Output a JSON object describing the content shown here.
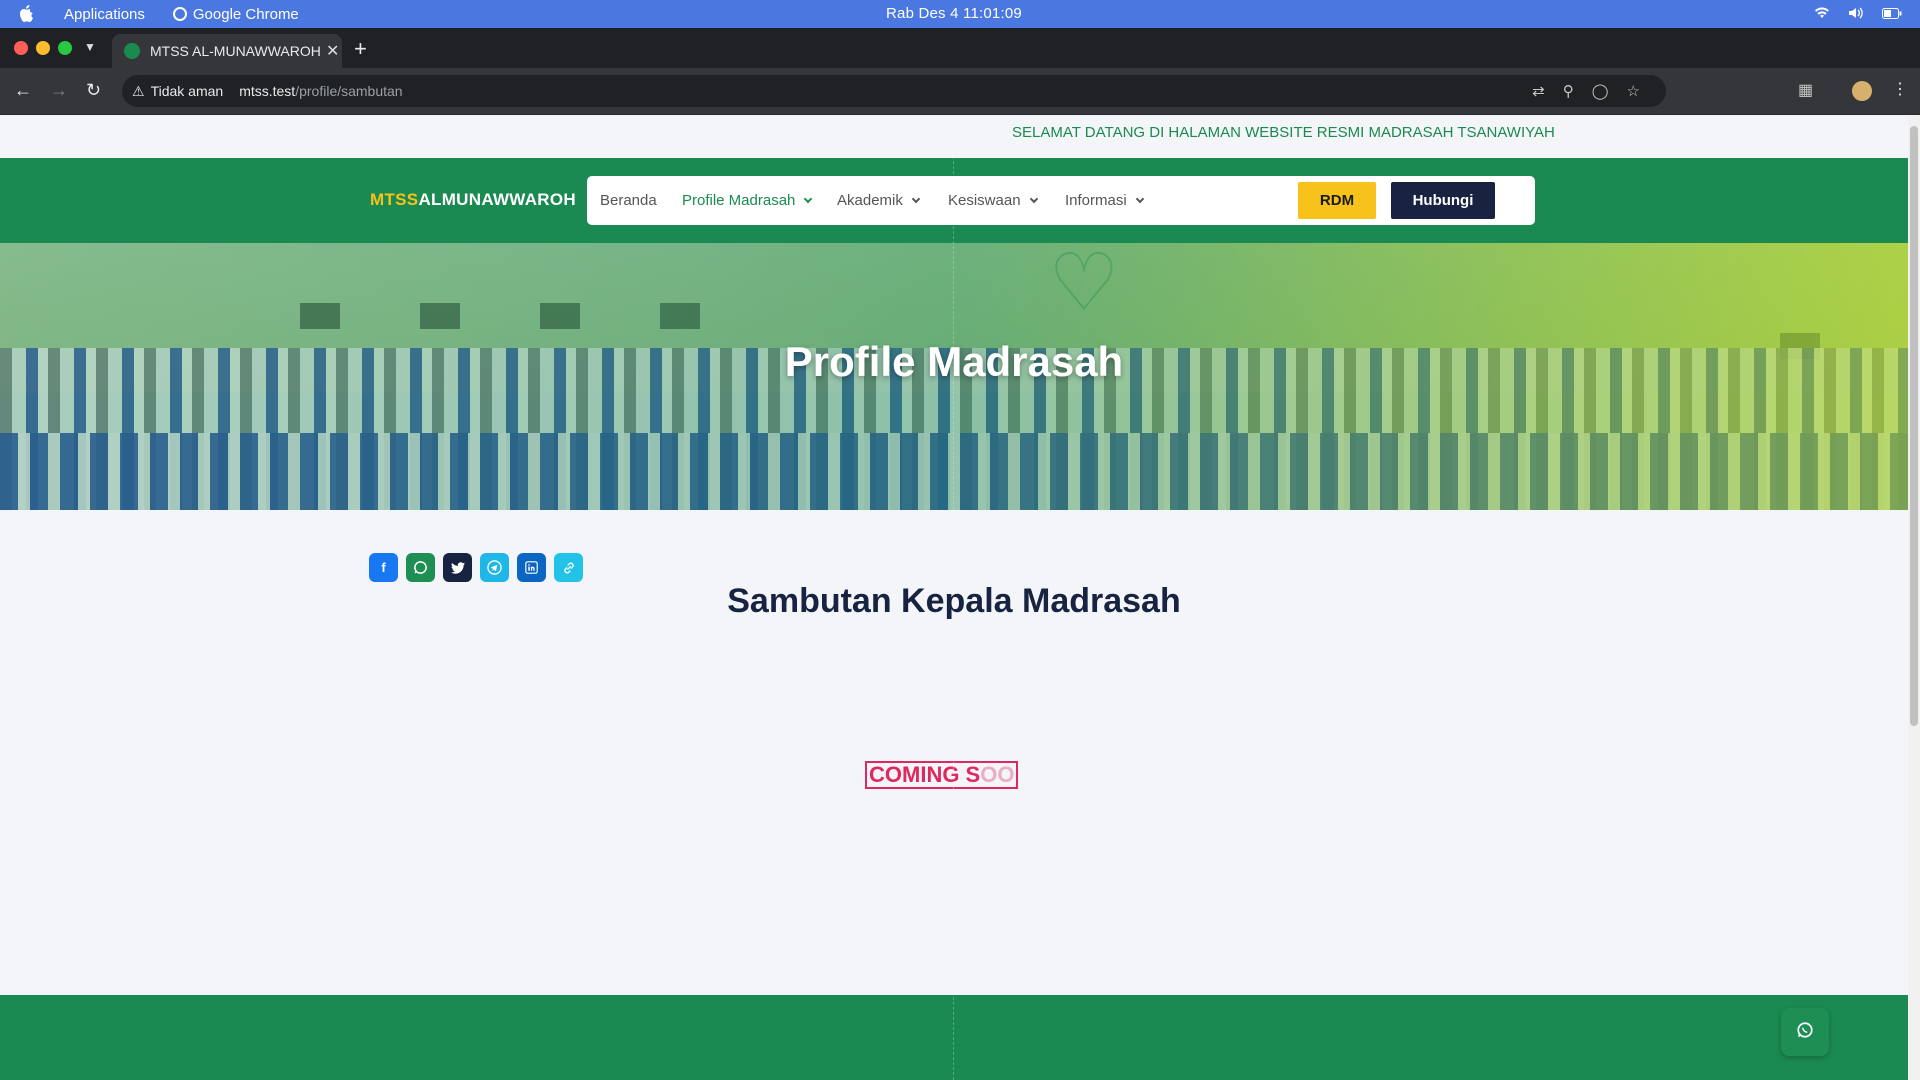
{
  "os": {
    "apps_label": "Applications",
    "browser_label": "Google Chrome",
    "clock": "Rab Des 4  11:01:09"
  },
  "browser": {
    "tab_title": "MTSS AL-MUNAWWAROH",
    "security_label": "Tidak aman",
    "url_host": "mtss.test",
    "url_path": "/profile/sambutan"
  },
  "page": {
    "ticker": "SELAMAT DATANG DI HALAMAN WEBSITE RESMI MADRASAH TSANAWIYAH",
    "logo_prefix": "MTSS",
    "logo_suffix": "ALMUNAWWAROH",
    "nav": [
      {
        "label": "Beranda"
      },
      {
        "label": "Profile Madrasah"
      },
      {
        "label": "Akademik"
      },
      {
        "label": "Kesiswaan"
      },
      {
        "label": "Informasi"
      }
    ],
    "btn_rdm": "RDM",
    "btn_hubungi": "Hubungi",
    "hero_title": "Profile Madrasah",
    "section_title": "Sambutan Kepala Madrasah",
    "coming_visible": "COMING S",
    "coming_faded": "OO"
  },
  "colors": {
    "brand_green": "#1b8a52",
    "accent_yellow": "#f7c21a",
    "navy": "#172340",
    "coming_pink": "#e0285f"
  },
  "icons": [
    "apple-icon",
    "wifi-icon",
    "volume-icon",
    "battery-icon",
    "facebook-icon",
    "whatsapp-icon",
    "twitter-icon",
    "telegram-icon",
    "linkedin-icon",
    "link-icon"
  ]
}
